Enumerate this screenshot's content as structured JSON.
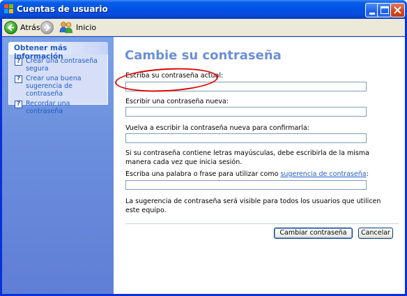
{
  "window": {
    "title": "Cuentas de usuario",
    "controls": {
      "minimize_icon": "minimize-icon",
      "maximize_icon": "maximize-icon",
      "close_icon": "close-icon"
    }
  },
  "toolbar": {
    "back_label": "Atrás",
    "home_label": "Inicio"
  },
  "sidebar": {
    "header": "Obtener más información",
    "items": [
      {
        "label": "Crear una contraseña segura"
      },
      {
        "label": "Crear una buena sugerencia de contraseña"
      },
      {
        "label": "Recordar una contraseña"
      }
    ]
  },
  "main": {
    "title": "Cambie su contraseña",
    "current_label": "Escriba su contraseña actual:",
    "current_value": "",
    "new_label": "Escribir una contraseña nueva:",
    "new_value": "",
    "confirm_label": "Vuelva a escribir la contraseña nueva para confirmarla:",
    "confirm_value": "",
    "case_note": "Si su contraseña contiene letras mayúsculas, debe escribirla de la misma manera cada vez que inicia sesión.",
    "hint_label_prefix": "Escriba una palabra o frase para utilizar como ",
    "hint_link": "sugerencia de contraseña",
    "hint_label_suffix": ":",
    "hint_value": "",
    "visibility_note": "La sugerencia de contraseña será visible para todos los usuarios que utilicen este equipo.",
    "change_button": "Cambiar contraseña",
    "cancel_button": "Cancelar"
  },
  "colors": {
    "heading": "#6c8fd6",
    "link": "#215dc6",
    "annotation": "#e00000"
  }
}
